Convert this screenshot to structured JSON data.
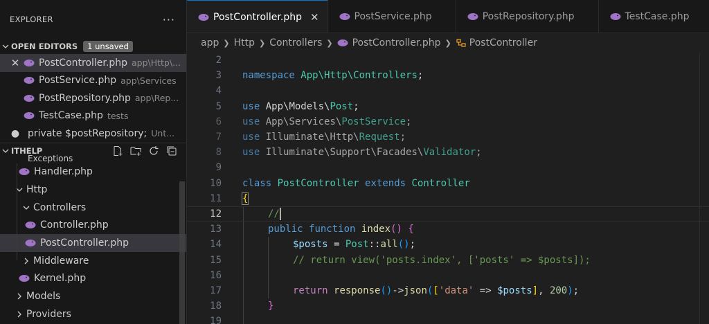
{
  "sidebar": {
    "title": "EXPLORER",
    "more": "···",
    "open_editors": {
      "label": "OPEN EDITORS",
      "badge": "1 unsaved",
      "items": [
        {
          "name": "PostController.php",
          "desc": "app\\Http\\..."
        },
        {
          "name": "PostService.php",
          "desc": "app\\Services"
        },
        {
          "name": "PostRepository.php",
          "desc": "app\\Rep..."
        },
        {
          "name": "TestCase.php",
          "desc": "tests"
        },
        {
          "name": "private $postRepository;",
          "desc": "Unt..."
        }
      ]
    },
    "project": {
      "label": "ITHELP",
      "tree": [
        {
          "label": "Exceptions"
        },
        {
          "label": "Handler.php"
        },
        {
          "label": "Http"
        },
        {
          "label": "Controllers"
        },
        {
          "label": "Controller.php"
        },
        {
          "label": "PostController.php"
        },
        {
          "label": "Middleware"
        },
        {
          "label": "Kernel.php"
        },
        {
          "label": "Models"
        },
        {
          "label": "Providers"
        }
      ]
    }
  },
  "tabs": [
    {
      "label": "PostController.php"
    },
    {
      "label": "PostService.php"
    },
    {
      "label": "PostRepository.php"
    },
    {
      "label": "TestCase.php"
    }
  ],
  "breadcrumb": [
    "app",
    "Http",
    "Controllers",
    "PostController.php",
    "PostController"
  ],
  "code": {
    "current_line": 12,
    "lines": [
      {
        "n": "2"
      },
      {
        "n": "3",
        "t": [
          "namespace",
          " ",
          "App\\Http\\Controllers",
          ";"
        ]
      },
      {
        "n": "4"
      },
      {
        "n": "5",
        "t": [
          "use",
          " App\\Models\\",
          "Post",
          ";"
        ]
      },
      {
        "n": "6",
        "t": [
          "use",
          " App\\Services\\",
          "PostService",
          ";"
        ]
      },
      {
        "n": "7",
        "t": [
          "use",
          " Illuminate\\Http\\",
          "Request",
          ";"
        ]
      },
      {
        "n": "8",
        "t": [
          "use",
          " Illuminate\\Support\\Facades\\",
          "Validator",
          ";"
        ]
      },
      {
        "n": "9"
      },
      {
        "n": "10",
        "t": [
          "class",
          " ",
          "PostController",
          " ",
          "extends",
          " ",
          "Controller"
        ]
      },
      {
        "n": "11",
        "t": [
          "{"
        ]
      },
      {
        "n": "12",
        "t": [
          "//"
        ]
      },
      {
        "n": "13",
        "t": [
          "public",
          " ",
          "function",
          " ",
          "index",
          "()",
          " ",
          "{"
        ]
      },
      {
        "n": "14",
        "t": [
          "$posts",
          " = ",
          "Post",
          "::",
          "all",
          "()",
          ";"
        ]
      },
      {
        "n": "15",
        "t": [
          "// return view('posts.index', ['posts' => $posts]);"
        ]
      },
      {
        "n": "16"
      },
      {
        "n": "17",
        "t": [
          "return",
          " ",
          "response",
          "()",
          "->",
          "json",
          "(",
          "[",
          "'data'",
          " => ",
          "$posts",
          "]",
          ", ",
          "200",
          ")",
          ";"
        ]
      },
      {
        "n": "18",
        "t": [
          "}"
        ]
      },
      {
        "n": "19"
      }
    ]
  },
  "colors": {
    "accent": "#0078d4",
    "php_icon": "#a074c4",
    "selection": "#37373d"
  }
}
